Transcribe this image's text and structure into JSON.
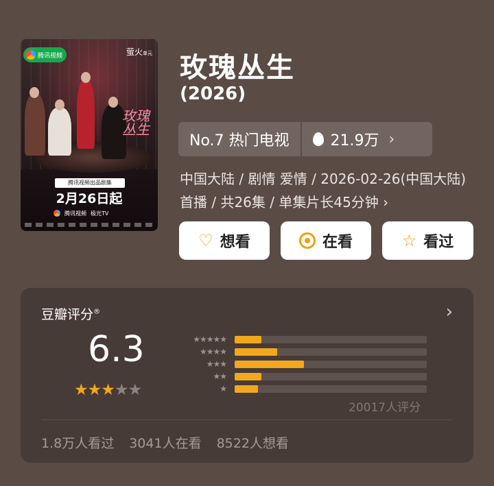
{
  "poster": {
    "platform_logo": "腾讯视频",
    "studio_logo": "萤火",
    "studio_sub": "单元",
    "title_art": "玫瑰丛生",
    "banner": "腾讯视频出品剧集",
    "date": "2月26日起",
    "platforms": [
      "腾讯视频",
      "极光TV"
    ]
  },
  "title": "玫瑰丛生",
  "year": "(2026)",
  "rank": {
    "label": "No.7 热门电视",
    "heat": "21.9万",
    "chevron": "›"
  },
  "meta": "中国大陆 / 剧情 爱情 / 2026-02-26(中国大陆)首播 / 共26集 / 单集片长45分钟 ›",
  "actions": {
    "want": "想看",
    "watching": "在看",
    "watched": "看过"
  },
  "rating": {
    "label": "豆瓣评分",
    "reg": "®",
    "score": "6.3",
    "stars_filled": 3,
    "stars_total": 5,
    "distribution": [
      {
        "stars": "★★★★★",
        "fraction": 0.14
      },
      {
        "stars": "★★★★",
        "fraction": 0.22
      },
      {
        "stars": "★★★",
        "fraction": 0.36
      },
      {
        "stars": "★★",
        "fraction": 0.14
      },
      {
        "stars": "★",
        "fraction": 0.12
      }
    ],
    "count": "20017人评分",
    "watched": "1.8万人看过",
    "watching": "3041人在看",
    "want": "8522人想看"
  },
  "colors": {
    "background": "#5a4b45",
    "card": "#473b37",
    "accent": "#f2a81d"
  },
  "icons": {
    "want": "heart-plus-icon",
    "watching": "target-icon",
    "watched": "star-outline-icon",
    "heat": "flame-icon"
  }
}
